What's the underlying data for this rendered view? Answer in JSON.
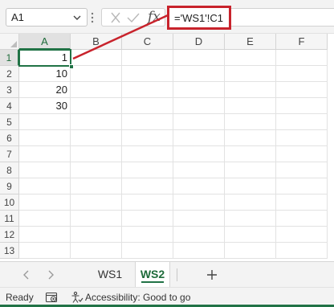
{
  "formula_bar": {
    "name_box": "A1",
    "formula": "='WS1'!C1",
    "icons": [
      "chevron-down-icon",
      "more-dots-icon",
      "cancel-x-icon",
      "enter-check-icon",
      "function-fx-icon"
    ],
    "fx_label": "fx"
  },
  "grid": {
    "columns": [
      "A",
      "B",
      "C",
      "D",
      "E",
      "F"
    ],
    "rows": [
      "1",
      "2",
      "3",
      "4",
      "5",
      "6",
      "7",
      "8",
      "9",
      "10",
      "11",
      "12",
      "13"
    ],
    "cells": [
      [
        "1",
        "",
        "",
        "",
        "",
        ""
      ],
      [
        "10",
        "",
        "",
        "",
        "",
        ""
      ],
      [
        "20",
        "",
        "",
        "",
        "",
        ""
      ],
      [
        "30",
        "",
        "",
        "",
        "",
        ""
      ],
      [
        "",
        "",
        "",
        "",
        "",
        ""
      ],
      [
        "",
        "",
        "",
        "",
        "",
        ""
      ],
      [
        "",
        "",
        "",
        "",
        "",
        ""
      ],
      [
        "",
        "",
        "",
        "",
        "",
        ""
      ],
      [
        "",
        "",
        "",
        "",
        "",
        ""
      ],
      [
        "",
        "",
        "",
        "",
        "",
        ""
      ],
      [
        "",
        "",
        "",
        "",
        "",
        ""
      ],
      [
        "",
        "",
        "",
        "",
        "",
        ""
      ],
      [
        "",
        "",
        "",
        "",
        "",
        ""
      ]
    ],
    "active_cell": "A1"
  },
  "sheets": {
    "tabs": [
      "WS1",
      "WS2"
    ],
    "active": "WS2",
    "icons": [
      "prev-sheet-icon",
      "next-sheet-icon",
      "add-sheet-icon"
    ]
  },
  "status_bar": {
    "ready": "Ready",
    "accessibility": "Accessibility: Good to go",
    "icons": [
      "macro-record-icon",
      "accessibility-icon"
    ]
  },
  "colors": {
    "accent_green": "#217346",
    "callout_red": "#c8232c"
  }
}
